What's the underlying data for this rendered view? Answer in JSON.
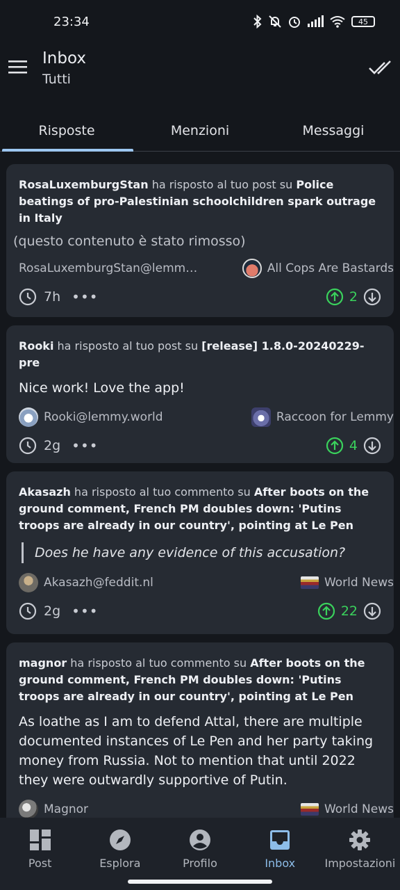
{
  "status": {
    "time": "23:34",
    "battery": "45"
  },
  "appbar": {
    "title": "Inbox",
    "subtitle": "Tutti"
  },
  "tabs": [
    "Risposte",
    "Menzioni",
    "Messaggi"
  ],
  "cards": [
    {
      "author": "RosaLuxemburgStan",
      "action": " ha risposto al tuo post su ",
      "target": "Police beatings of pro-Palestinian schoolchildren spark outrage in Italy",
      "content": "(questo contenuto è stato rimosso)",
      "user": "RosaLuxemburgStan@lemm…",
      "community": "All Cops Are Bastards",
      "time": "7h",
      "score": "2"
    },
    {
      "author": "Rooki",
      "action": " ha risposto al tuo post su ",
      "target": "[release] 1.8.0-20240229-pre",
      "content": "Nice work! Love the app!",
      "user": "Rooki@lemmy.world",
      "community": "Raccoon for Lemmy",
      "time": "2g",
      "score": "4"
    },
    {
      "author": "Akasazh",
      "action": " ha risposto al tuo commento su ",
      "target": "After boots on the ground comment, French PM doubles down: 'Putins troops are already in our country', pointing at Le Pen",
      "content": "Does he have any evidence of this accusation?",
      "user": "Akasazh@feddit.nl",
      "community": "World News",
      "time": "2g",
      "score": "22"
    },
    {
      "author": "magnor",
      "action": " ha risposto al tuo commento su ",
      "target": "After boots on the ground comment, French PM doubles down: 'Putins troops are already in our country', pointing at Le Pen",
      "content": "As loathe as I am to defend Attal, there are multiple documented instances of Le Pen and her party taking money from Russia. Not to mention that until 2022 they were outwardly supportive of Putin.",
      "user": "Magnor",
      "community": "World News"
    }
  ],
  "more_glyph": "•••",
  "bottom_nav": [
    "Post",
    "Esplora",
    "Profilo",
    "Inbox",
    "Impostazioni"
  ],
  "colors": {
    "accent": "#8dbde9",
    "upvote": "#3ad25c",
    "card": "#262b33",
    "background": "#14171c"
  }
}
